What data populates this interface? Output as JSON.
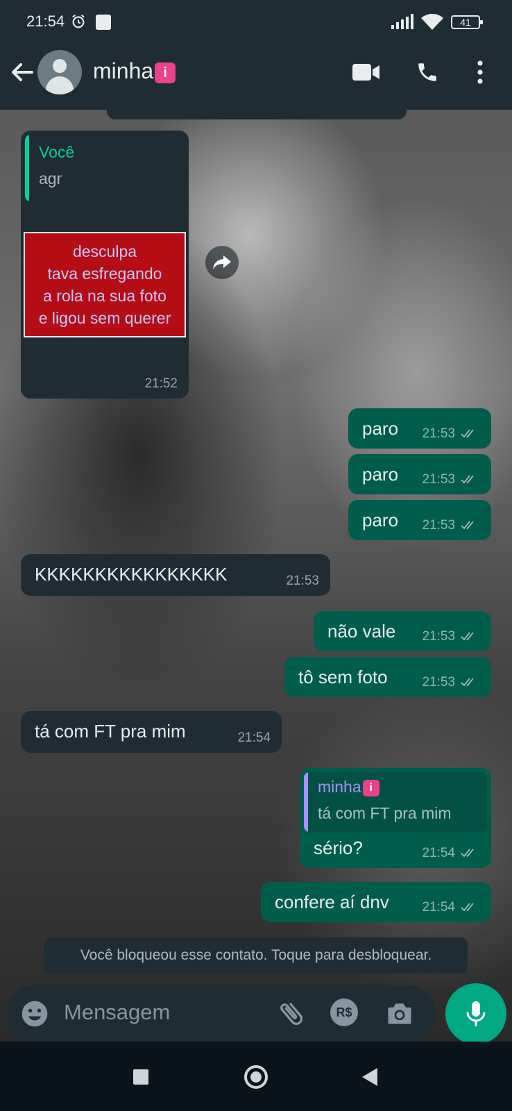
{
  "status_bar": {
    "time": "21:54",
    "battery": "41"
  },
  "header": {
    "contact_name": "minha",
    "contact_emoji": "i"
  },
  "messages": {
    "m1": {
      "quote_author": "Você",
      "quote_text": "agr",
      "sticker_lines": [
        "desculpa",
        "tava esfregando",
        "a rola na sua foto",
        "e ligou sem querer"
      ],
      "time": "21:52"
    },
    "m2": {
      "text": "paro",
      "time": "21:53"
    },
    "m3": {
      "text": "paro",
      "time": "21:53"
    },
    "m4": {
      "text": "paro",
      "time": "21:53"
    },
    "m5": {
      "text": "KKKKKKKKKKKKKKKK",
      "time": "21:53"
    },
    "m6": {
      "text": "não vale",
      "time": "21:53"
    },
    "m7": {
      "text": "tô sem foto",
      "time": "21:53"
    },
    "m8": {
      "text": "tá com FT pra mim",
      "time": "21:54"
    },
    "m9": {
      "quote_author": "minha",
      "quote_emoji": "i",
      "quote_text": "tá com FT pra mim",
      "text": "sério?",
      "time": "21:54"
    },
    "m10": {
      "text": "confere aí dnv",
      "time": "21:54"
    }
  },
  "blocked_notice": "Você bloqueou esse contato. Toque para desbloquear.",
  "composer": {
    "placeholder": "Mensagem",
    "pay_label": "R$"
  },
  "colors": {
    "header": "#1f2c34",
    "incoming": "#1f2c34",
    "outgoing": "#005c4b",
    "accent": "#00a884",
    "quote_you": "#06cf9c",
    "quote_contact": "#a791ff"
  },
  "icons": [
    "back-arrow-icon",
    "video-call-icon",
    "phone-icon",
    "more-vert-icon",
    "forward-icon",
    "read-ticks-icon",
    "emoji-icon",
    "attach-icon",
    "camera-icon",
    "mic-icon"
  ]
}
